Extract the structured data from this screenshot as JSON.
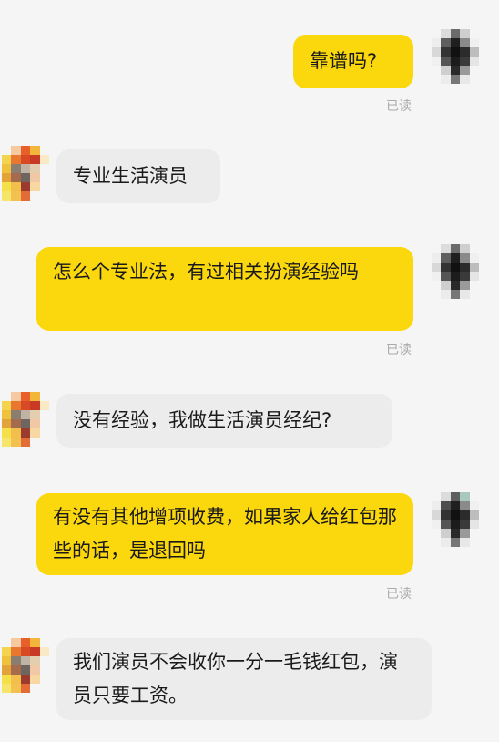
{
  "messages": [
    {
      "sender": "me",
      "text": "靠谱吗?",
      "read_label": "已读"
    },
    {
      "sender": "them",
      "text": "专业生活演员"
    },
    {
      "sender": "me",
      "text": "怎么个专业法，有过相关扮演经验吗",
      "read_label": "已读"
    },
    {
      "sender": "them",
      "text": "没有经验，我做生活演员经纪?"
    },
    {
      "sender": "me",
      "text": "有没有其他增项收费，如果家人给红包那些的话，是退回吗",
      "read_label": "已读"
    },
    {
      "sender": "them",
      "text": "我们演员不会收你一分一毛钱红包，演员只要工资。"
    }
  ],
  "colors": {
    "my_bubble": "#fbd70d",
    "their_bubble": "#ececec",
    "background": "#f5f5f5",
    "read_text": "#a9a9a9"
  }
}
